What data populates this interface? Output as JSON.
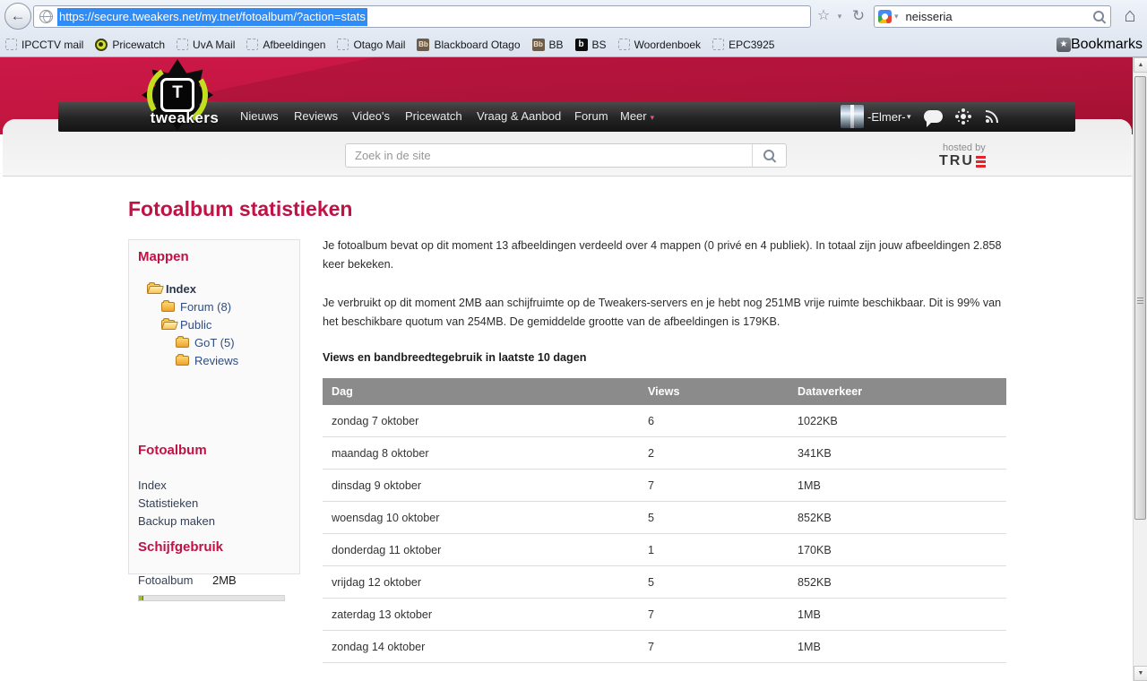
{
  "browser": {
    "url": "https://secure.tweakers.net/my.tnet/fotoalbum/?action=stats",
    "search_query": "neisseria",
    "bookmarks": [
      {
        "label": "IPCCTV mail",
        "icon": "placeholder"
      },
      {
        "label": "Pricewatch",
        "icon": "pricewatch"
      },
      {
        "label": "UvA Mail",
        "icon": "placeholder"
      },
      {
        "label": "Afbeeldingen",
        "icon": "placeholder"
      },
      {
        "label": "Otago Mail",
        "icon": "placeholder"
      },
      {
        "label": "Blackboard Otago",
        "icon": "blackboard"
      },
      {
        "label": "BB",
        "icon": "blackboard"
      },
      {
        "label": "BS",
        "icon": "b-black"
      },
      {
        "label": "Woordenboek",
        "icon": "placeholder"
      },
      {
        "label": "EPC3925",
        "icon": "placeholder"
      }
    ],
    "bookmarks_button": "Bookmarks"
  },
  "site_header": {
    "logo_letter": "T",
    "logo_word": "tweakers",
    "nav": [
      "Nieuws",
      "Reviews",
      "Video's",
      "Pricewatch",
      "Vraag & Aanbod",
      "Forum"
    ],
    "meer_label": "Meer",
    "user_name": "-Elmer-",
    "search_placeholder": "Zoek in de site",
    "hosted_by": "hosted by",
    "hosted_brand": "TRU"
  },
  "page": {
    "title": "Fotoalbum statistieken",
    "sidebar": {
      "mappen_title": "Mappen",
      "tree": [
        {
          "label": "Index",
          "level": 0,
          "folder": "open",
          "current": true
        },
        {
          "label": "Forum (8)",
          "level": 1,
          "folder": "closed",
          "current": false
        },
        {
          "label": "Public",
          "level": 1,
          "folder": "open",
          "current": false
        },
        {
          "label": "GoT (5)",
          "level": 2,
          "folder": "closed",
          "current": false
        },
        {
          "label": "Reviews",
          "level": 2,
          "folder": "closed",
          "current": false
        }
      ],
      "fotoalbum_title": "Fotoalbum",
      "fotoalbum_links": [
        "Index",
        "Statistieken",
        "Backup maken"
      ],
      "schijfgebruik_title": "Schijfgebruik",
      "disk": {
        "label": "Fotoalbum",
        "value": "2MB",
        "used_fraction": 0.03
      }
    },
    "intro_1": "Je fotoalbum bevat op dit moment 13 afbeeldingen verdeeld over 4 mappen (0 privé en 4 publiek). In totaal zijn jouw afbeeldingen 2.858 keer bekeken.",
    "intro_2": "Je verbruikt op dit moment 2MB aan schijfruimte op de Tweakers-servers en je hebt nog 251MB vrije ruimte beschikbaar. Dit is 99% van het beschikbare quotum van 254MB. De gemiddelde grootte van de afbeeldingen is 179KB.",
    "table_title": "Views en bandbreedtegebruik in laatste 10 dagen",
    "table": {
      "columns": [
        "Dag",
        "Views",
        "Dataverkeer"
      ],
      "rows": [
        [
          "zondag 7 oktober",
          "6",
          "1022KB"
        ],
        [
          "maandag 8 oktober",
          "2",
          "341KB"
        ],
        [
          "dinsdag 9 oktober",
          "7",
          "1MB"
        ],
        [
          "woensdag 10 oktober",
          "5",
          "852KB"
        ],
        [
          "donderdag 11 oktober",
          "1",
          "170KB"
        ],
        [
          "vrijdag 12 oktober",
          "5",
          "852KB"
        ],
        [
          "zaterdag 13 oktober",
          "7",
          "1MB"
        ],
        [
          "zondag 14 oktober",
          "7",
          "1MB"
        ]
      ]
    }
  },
  "colors": {
    "accent_crimson": "#c01245",
    "banner_red": "#c2163f",
    "navbar_dark": "#232323",
    "table_header_bg": "#8b8b8b",
    "lime_logo": "#c3de1f",
    "link_blue": "#2f4d80"
  }
}
